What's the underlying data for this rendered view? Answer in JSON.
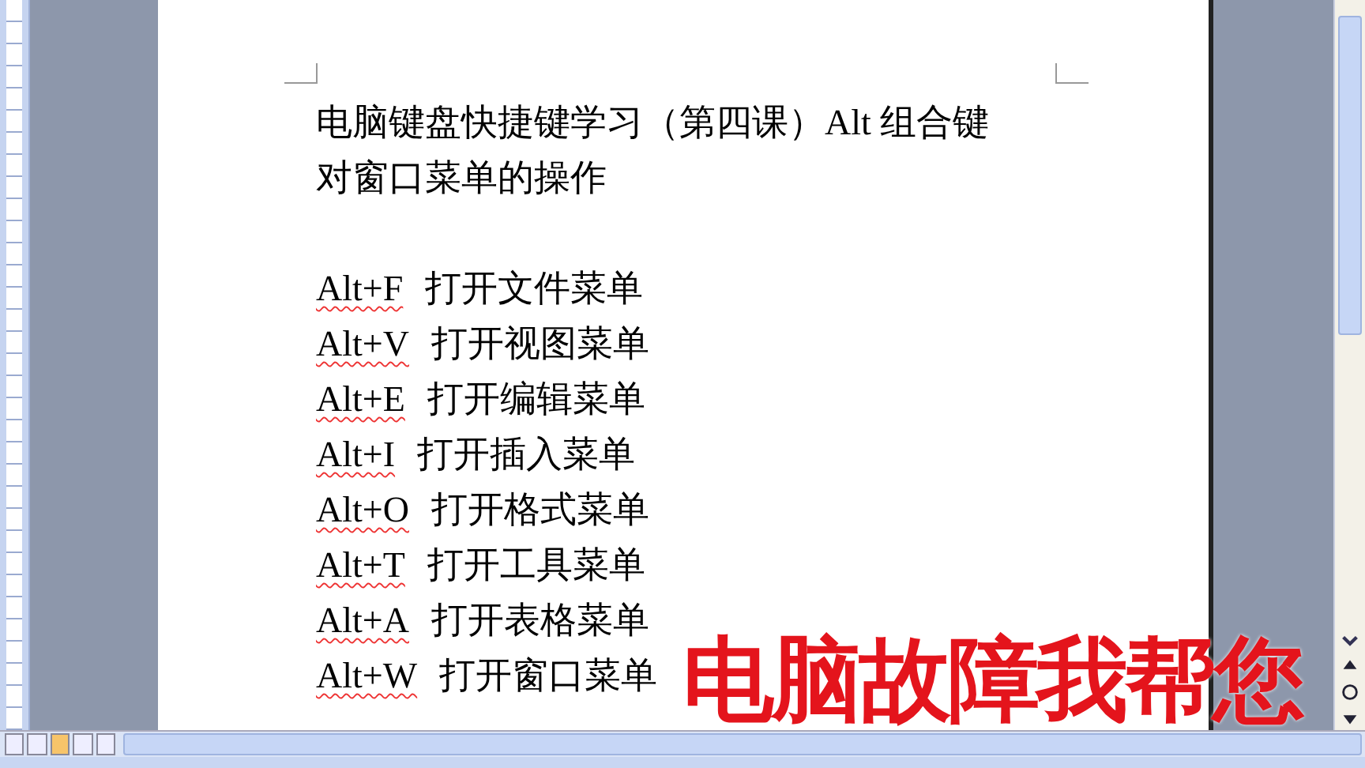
{
  "document": {
    "title_lines": [
      "电脑键盘快捷键学习（第四课）Alt  组合键",
      "对窗口菜单的操作"
    ],
    "shortcuts": [
      {
        "key": "Alt+F",
        "action": "打开文件菜单",
        "spell_error": true
      },
      {
        "key": "Alt+V",
        "action": "打开视图菜单",
        "spell_error": true
      },
      {
        "key": "Alt+E",
        "action": "打开编辑菜单",
        "spell_error": true
      },
      {
        "key": "Alt+I",
        "action": "打开插入菜单",
        "spell_error": true
      },
      {
        "key": "Alt+O",
        "action": "打开格式菜单",
        "spell_error": true
      },
      {
        "key": "Alt+T",
        "action": "打开工具菜单",
        "spell_error": true
      },
      {
        "key": "Alt+A",
        "action": "打开表格菜单",
        "spell_error": true
      },
      {
        "key": "Alt+W",
        "action": "打开窗口菜单",
        "spell_error": true
      }
    ]
  },
  "overlay_caption": "电脑故障我帮您"
}
